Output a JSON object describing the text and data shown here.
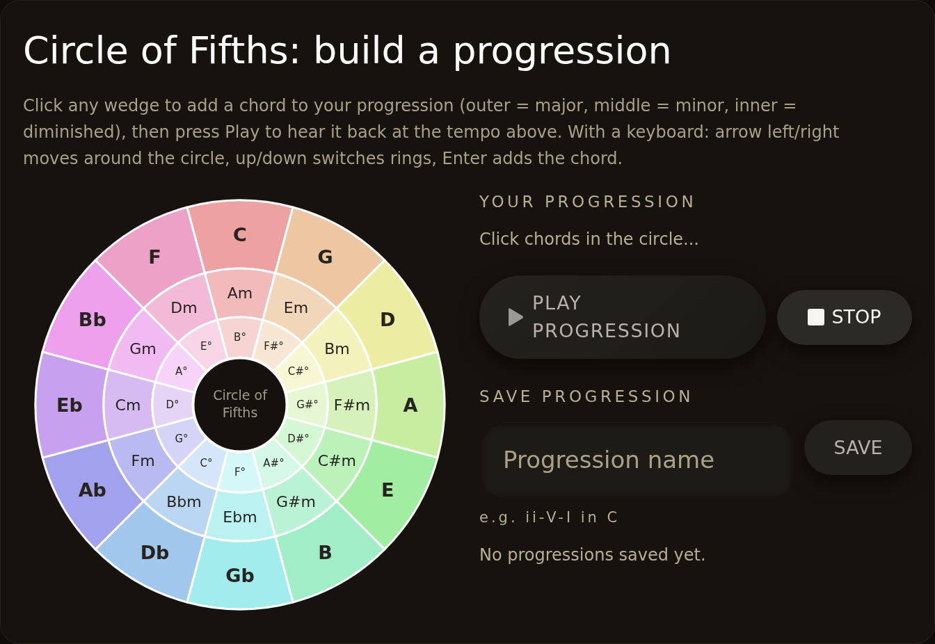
{
  "title": "Circle of Fifths: build a progression",
  "instructions": "Click any wedge to add a chord to your progression (outer = major, middle = minor, inner = diminished), then press Play to hear it back at the tempo above. With a keyboard: arrow left/right moves around the circle, up/down switches rings, Enter adds the chord.",
  "circle": {
    "center_label": "Circle of Fifths",
    "rings": [
      {
        "kind": "major",
        "chords": [
          {
            "label": "C",
            "color": "#eda1a1"
          },
          {
            "label": "G",
            "color": "#edc7a1"
          },
          {
            "label": "D",
            "color": "#ededa1"
          },
          {
            "label": "A",
            "color": "#c7eda1"
          },
          {
            "label": "E",
            "color": "#a1eda1"
          },
          {
            "label": "B",
            "color": "#a1edc7"
          },
          {
            "label": "Gb",
            "color": "#a1eded"
          },
          {
            "label": "Db",
            "color": "#a1c7ed"
          },
          {
            "label": "Ab",
            "color": "#a1a1ed"
          },
          {
            "label": "Eb",
            "color": "#c7a1ed"
          },
          {
            "label": "Bb",
            "color": "#eda1ed"
          },
          {
            "label": "F",
            "color": "#eda1c7"
          }
        ]
      },
      {
        "kind": "minor",
        "chords": [
          {
            "label": "Am",
            "color": "#f2baba"
          },
          {
            "label": "Em",
            "color": "#f2d6ba"
          },
          {
            "label": "Bm",
            "color": "#f2f2ba"
          },
          {
            "label": "F#m",
            "color": "#d6f2ba"
          },
          {
            "label": "C#m",
            "color": "#baf2ba"
          },
          {
            "label": "G#m",
            "color": "#baf2d6"
          },
          {
            "label": "Ebm",
            "color": "#baf2f2"
          },
          {
            "label": "Bbm",
            "color": "#bad6f2"
          },
          {
            "label": "Fm",
            "color": "#babaf2"
          },
          {
            "label": "Cm",
            "color": "#d6baf2"
          },
          {
            "label": "Gm",
            "color": "#f2baf2"
          },
          {
            "label": "Dm",
            "color": "#f2bad6"
          }
        ]
      },
      {
        "kind": "diminished",
        "chords": [
          {
            "label": "B°",
            "color": "#f7d4d4"
          },
          {
            "label": "F#°",
            "color": "#f7e6d4"
          },
          {
            "label": "C#°",
            "color": "#f7f7d4"
          },
          {
            "label": "G#°",
            "color": "#e6f7d4"
          },
          {
            "label": "D#°",
            "color": "#d4f7d4"
          },
          {
            "label": "A#°",
            "color": "#d4f7e6"
          },
          {
            "label": "F°",
            "color": "#d4f7f7"
          },
          {
            "label": "C°",
            "color": "#d4e6f7"
          },
          {
            "label": "G°",
            "color": "#d4d4f7"
          },
          {
            "label": "D°",
            "color": "#e6d4f7"
          },
          {
            "label": "A°",
            "color": "#f7d4f7"
          },
          {
            "label": "E°",
            "color": "#f7d4e6"
          }
        ]
      }
    ]
  },
  "progression": {
    "heading": "YOUR PROGRESSION",
    "empty_text": "Click chords in the circle...",
    "buttons": [
      {
        "kind": "play",
        "label": "PLAY PROGRESSION"
      },
      {
        "kind": "stop",
        "label": "STOP"
      }
    ]
  },
  "save": {
    "heading": "SAVE PROGRESSION",
    "name_field": {
      "placeholder": "Progression name"
    },
    "button": "SAVE",
    "hint": "e.g. ii-V-I in C",
    "saved_list_text": "No progressions saved yet."
  }
}
